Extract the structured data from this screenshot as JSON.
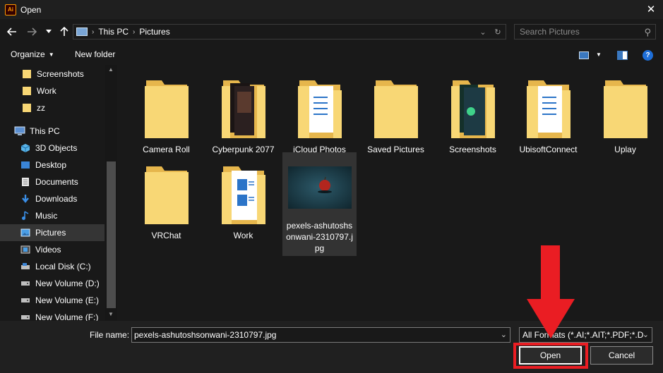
{
  "window": {
    "title": "Open",
    "app_icon_text": "Ai"
  },
  "address": {
    "crumbs": [
      "This PC",
      "Pictures"
    ]
  },
  "search": {
    "placeholder": "Search Pictures"
  },
  "toolbar": {
    "organize_label": "Organize",
    "new_folder_label": "New folder"
  },
  "sidebar": {
    "items": [
      {
        "label": "Screenshots",
        "icon": "folder-icon"
      },
      {
        "label": "Work",
        "icon": "folder-icon"
      },
      {
        "label": "zz",
        "icon": "folder-icon"
      },
      {
        "label": "This PC",
        "icon": "computer-icon"
      },
      {
        "label": "3D Objects",
        "icon": "cube-icon"
      },
      {
        "label": "Desktop",
        "icon": "desktop-icon"
      },
      {
        "label": "Documents",
        "icon": "document-icon"
      },
      {
        "label": "Downloads",
        "icon": "download-icon"
      },
      {
        "label": "Music",
        "icon": "music-icon"
      },
      {
        "label": "Pictures",
        "icon": "pictures-icon"
      },
      {
        "label": "Videos",
        "icon": "video-icon"
      },
      {
        "label": "Local Disk (C:)",
        "icon": "disk-icon"
      },
      {
        "label": "New Volume (D:)",
        "icon": "drive-icon"
      },
      {
        "label": "New Volume (E:)",
        "icon": "drive-icon"
      },
      {
        "label": "New Volume (F:)",
        "icon": "drive-icon"
      }
    ],
    "selected": "Pictures"
  },
  "files": [
    {
      "label": "Camera Roll",
      "type": "folder"
    },
    {
      "label": "Cyberpunk 2077",
      "type": "folder-images"
    },
    {
      "label": "iCloud Photos",
      "type": "folder-docs"
    },
    {
      "label": "Saved Pictures",
      "type": "folder"
    },
    {
      "label": "Screenshots",
      "type": "folder-images"
    },
    {
      "label": "UbisoftConnect",
      "type": "folder-docs"
    },
    {
      "label": "Uplay",
      "type": "folder"
    },
    {
      "label": "VRChat",
      "type": "folder"
    },
    {
      "label": "Work",
      "type": "folder-docs"
    },
    {
      "label": "pexels-ashutoshsonwani-2310797.jpg",
      "type": "image"
    }
  ],
  "footer": {
    "file_name_label": "File name:",
    "file_name_value": "pexels-ashutoshsonwani-2310797.jpg",
    "file_type_value": "All Formats (*.AI;*.AIT;*.PDF;*.D",
    "open_label": "Open",
    "cancel_label": "Cancel"
  },
  "colors": {
    "folder": "#f8d775",
    "folder_dark": "#e6b64c",
    "annotation": "#ea1d23",
    "selection": "#353535"
  }
}
